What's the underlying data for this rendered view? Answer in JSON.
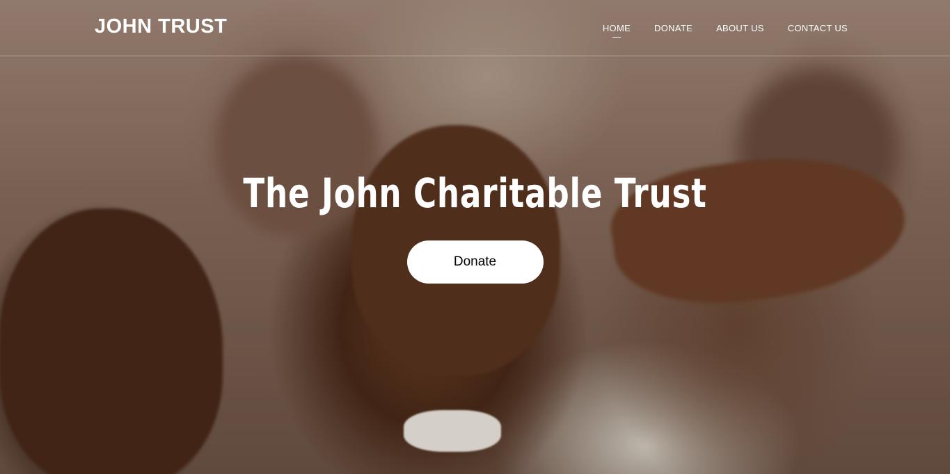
{
  "header": {
    "brand": "JOHN TRUST",
    "nav": [
      {
        "label": "HOME",
        "active": true
      },
      {
        "label": "DONATE",
        "active": false
      },
      {
        "label": "ABOUT US",
        "active": false
      },
      {
        "label": "CONTACT US",
        "active": false
      }
    ]
  },
  "hero": {
    "title": "The John Charitable Trust",
    "cta_label": "Donate"
  }
}
